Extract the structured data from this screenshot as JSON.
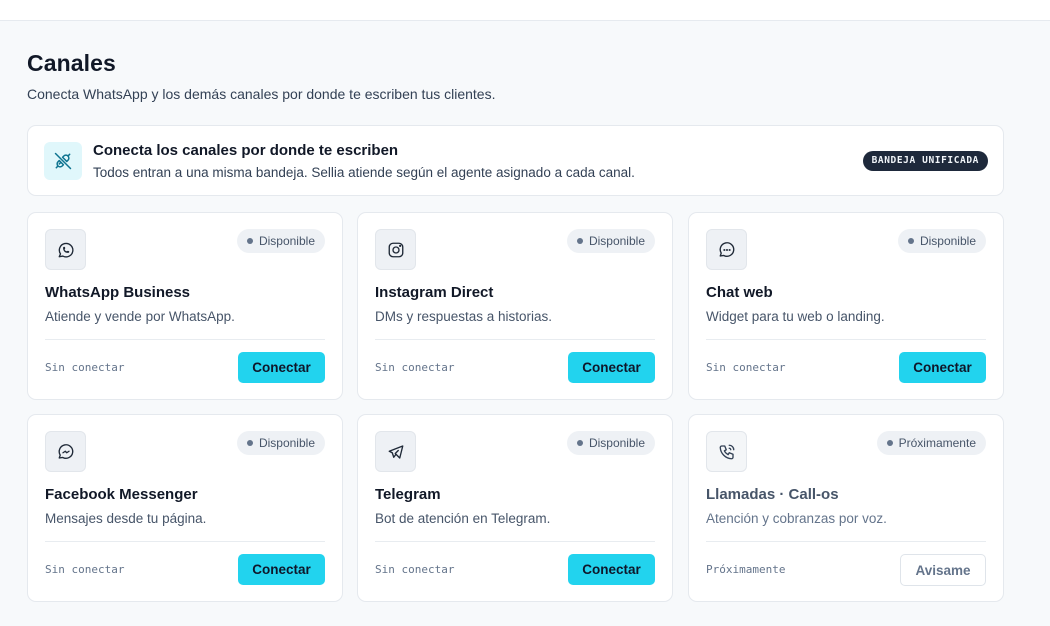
{
  "header": {
    "title": "Canales",
    "subtitle": "Conecta WhatsApp y los demás canales por donde te escriben tus clientes."
  },
  "banner": {
    "icon": "plug-off-icon",
    "title": "Conecta los canales por donde te escriben",
    "description": "Todos entran a una misma bandeja. Sellia atiende según el agente asignado a cada canal.",
    "badge": "BANDEJA UNIFICADA"
  },
  "colors": {
    "accent": "#22d3ee",
    "badge_bg": "#1e293b",
    "status_dot": "#64748b"
  },
  "channels": [
    {
      "icon": "whatsapp-icon",
      "status": "Disponible",
      "title": "WhatsApp Business",
      "description": "Atiende y vende por WhatsApp.",
      "state": "Sin conectar",
      "action": "Conectar"
    },
    {
      "icon": "instagram-icon",
      "status": "Disponible",
      "title": "Instagram Direct",
      "description": "DMs y respuestas a historias.",
      "state": "Sin conectar",
      "action": "Conectar"
    },
    {
      "icon": "chat-bubble-icon",
      "status": "Disponible",
      "title": "Chat web",
      "description": "Widget para tu web o landing.",
      "state": "Sin conectar",
      "action": "Conectar"
    },
    {
      "icon": "messenger-icon",
      "status": "Disponible",
      "title": "Facebook Messenger",
      "description": "Mensajes desde tu página.",
      "state": "Sin conectar",
      "action": "Conectar"
    },
    {
      "icon": "telegram-icon",
      "status": "Disponible",
      "title": "Telegram",
      "description": "Bot de atención en Telegram.",
      "state": "Sin conectar",
      "action": "Conectar"
    },
    {
      "icon": "phone-call-icon",
      "status": "Próximamente",
      "title": "Llamadas · Call-os",
      "description": "Atención y cobranzas por voz.",
      "state": "Próximamente",
      "action": "Avisame"
    }
  ]
}
